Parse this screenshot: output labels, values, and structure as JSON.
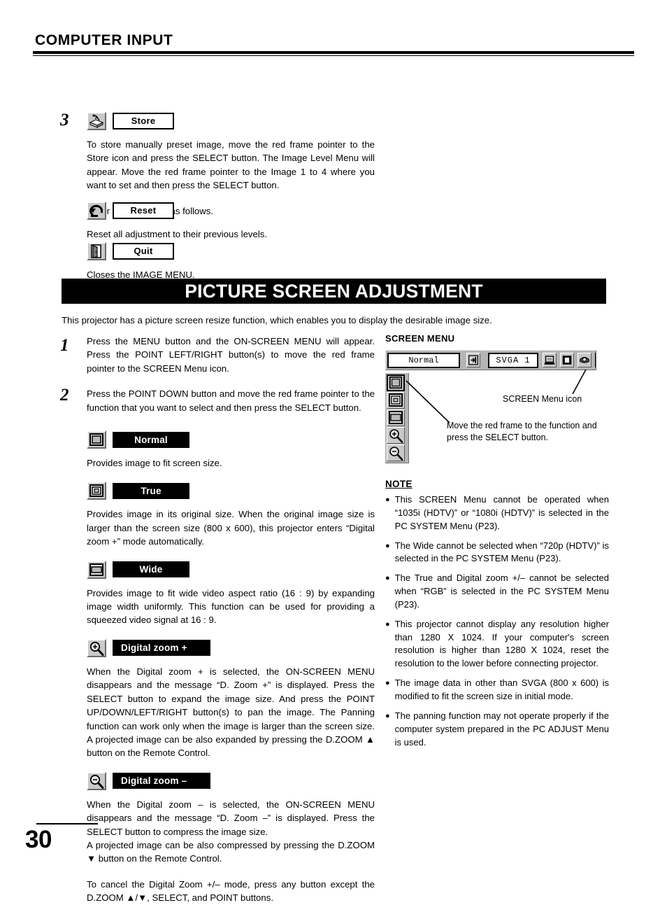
{
  "header": {
    "title": "COMPUTER INPUT"
  },
  "store_section": {
    "step_number": "3",
    "icon_name": "store-icon",
    "label": "Store",
    "paragraph": "To store manually preset image, move the red frame pointer to the Store icon and press the SELECT button.  The Image Level Menu will appear.  Move the red frame pointer to the Image 1 to 4 where you want to set and then press the SELECT button.",
    "other_icons_note": "Other icons operate as follows."
  },
  "reset_section": {
    "icon_name": "reset-arrow-icon",
    "label": "Reset",
    "paragraph": "Reset all adjustment to their previous levels."
  },
  "quit_section": {
    "icon_name": "quit-door-icon",
    "label": "Quit",
    "paragraph": "Closes the IMAGE MENU."
  },
  "banner": {
    "title": "PICTURE SCREEN ADJUSTMENT"
  },
  "intro": {
    "text": "This projector has a picture screen resize function, which enables you to display the desirable image size."
  },
  "steps": [
    {
      "number": "1",
      "text": "Press the MENU button and the ON-SCREEN MENU will appear.  Press the POINT LEFT/RIGHT button(s) to move the red frame pointer to the SCREEN Menu icon."
    },
    {
      "number": "2",
      "text": "Press the POINT DOWN button and move the red frame pointer to the function that you want to select and then press the SELECT button."
    }
  ],
  "functions": [
    {
      "icon_name": "normal-screen-icon",
      "label": "Normal",
      "text": "Provides image to fit screen size."
    },
    {
      "icon_name": "true-screen-icon",
      "label": "True",
      "text": "Provides image in its original size.  When the original image size is larger than the screen size (800 x 600), this projector enters “Digital zoom +” mode automatically."
    },
    {
      "icon_name": "wide-screen-icon",
      "label": "Wide",
      "text": "Provides image to fit wide video aspect ratio (16 : 9) by expanding image width uniformly.  This function can be used for providing a squeezed video signal at 16 : 9."
    },
    {
      "icon_name": "digital-zoom-in-icon",
      "label": "Digital zoom +",
      "text": "When the Digital zoom + is selected, the ON-SCREEN MENU disappears and the message “D. Zoom +” is displayed.  Press the SELECT button to expand the image size.  And press the POINT UP/DOWN/LEFT/RIGHT button(s) to pan the image.  The Panning function can work only when the image is larger than the screen size. A projected image can be also expanded by pressing the D.ZOOM ▲ button on the Remote Control."
    },
    {
      "icon_name": "digital-zoom-out-icon",
      "label": "Digital zoom –",
      "text": "When the Digital zoom – is selected, the ON-SCREEN MENU disappears and the message “D. Zoom –” is displayed.  Press the SELECT button to compress the image size.\nA projected image can be also compressed by pressing the D.ZOOM ▼ button on the Remote Control."
    }
  ],
  "cancel_note": "To cancel the Digital Zoom +/– mode, press any button except the D.ZOOM ▲/▼, SELECT, and POINT buttons.",
  "screen_menu_figure": {
    "title": "SCREEN MENU",
    "mode_value": "Normal",
    "system_value": "SVGA 1",
    "menubar_icons": [
      "input-source-icon",
      "pc-system-icon",
      "image-select-icon",
      "image-adjust-icon",
      "screen-menu-icon"
    ],
    "strip_icons": [
      "normal-screen-icon",
      "true-screen-icon",
      "wide-screen-icon",
      "digital-zoom-in-icon",
      "digital-zoom-out-icon"
    ],
    "callout_icon": "SCREEN Menu icon",
    "callout_frame": "Move the red frame to the function and press the SELECT button."
  },
  "note": {
    "heading": "NOTE",
    "bullet_glyph": "●",
    "items": [
      "This SCREEN Menu cannot be operated when “1035i (HDTV)” or “1080i (HDTV)” is selected in the PC SYSTEM Menu  (P23).",
      "The Wide cannot be selected when “720p (HDTV)” is selected in the PC SYSTEM Menu (P23).",
      "The True and Digital zoom +/– cannot be selected when “RGB” is selected in the PC SYSTEM Menu  (P23).",
      "This projector cannot display any resolution higher  than 1280 X 1024.  If your computer's screen resolution is higher than 1280 X 1024, reset the resolution to the lower before connecting projector.",
      "The image data in other than SVGA (800 x 600) is modified to fit the screen size in initial mode.",
      "The panning function may not operate properly if the computer system prepared in the PC ADJUST Menu is used."
    ]
  },
  "footer": {
    "page_number": "30"
  },
  "colors": {
    "banner_bg": "#000000",
    "banner_text": "#ffffff",
    "icon_face": "#c9c9c9",
    "menubar_bg": "#b5b5b5"
  }
}
